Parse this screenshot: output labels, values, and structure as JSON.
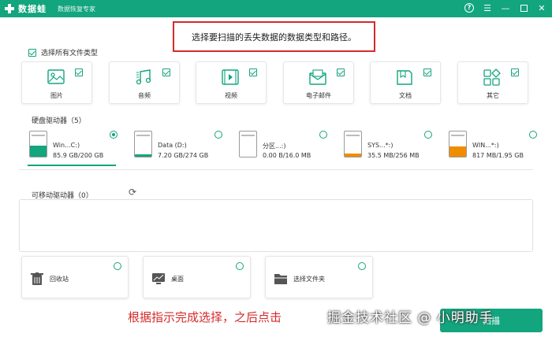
{
  "titlebar": {
    "app_name": "数据蛙",
    "subtitle": "数据恢复专家",
    "help_icon": "question-circle-icon",
    "menu_icon": "hamburger-icon",
    "min_icon": "minimize-icon",
    "max_icon": "restore-icon",
    "close_icon": "close-icon"
  },
  "banner": "选择要扫描的丢失数据的数据类型和路径。",
  "select_all": {
    "label": "选择所有文件类型",
    "checked": true
  },
  "file_types": [
    {
      "label": "图片",
      "icon": "image-icon",
      "checked": true
    },
    {
      "label": "音频",
      "icon": "music-icon",
      "checked": true
    },
    {
      "label": "视频",
      "icon": "video-icon",
      "checked": true
    },
    {
      "label": "电子邮件",
      "icon": "email-icon",
      "checked": true
    },
    {
      "label": "文档",
      "icon": "document-icon",
      "checked": true
    },
    {
      "label": "其它",
      "icon": "other-icon",
      "checked": true
    }
  ],
  "hard_drives": {
    "label": "硬盘驱动器（5）",
    "items": [
      {
        "name": "Win...C:)",
        "size": "85.9 GB/200 GB",
        "used_fraction": 0.43,
        "color": "#12a57e",
        "selected": true
      },
      {
        "name": "Data (D:)",
        "size": "7.20 GB/274 GB",
        "used_fraction": 0.03,
        "color": "#12a57e",
        "selected": false
      },
      {
        "name": "分区...:)",
        "size": "0.00  B/16.0 MB",
        "used_fraction": 0.0,
        "color": "#f08c00",
        "selected": false
      },
      {
        "name": "SYS...*:)",
        "size": "35.5 MB/256 MB",
        "used_fraction": 0.14,
        "color": "#f08c00",
        "selected": false
      },
      {
        "name": "WIN...*:)",
        "size": "817 MB/1.95 GB",
        "used_fraction": 0.42,
        "color": "#f08c00",
        "selected": false
      }
    ]
  },
  "removable": {
    "label": "可移动驱动器（0）",
    "refresh_icon": "refresh-icon"
  },
  "locations": [
    {
      "label": "回收站",
      "icon": "recycle-bin-icon"
    },
    {
      "label": "桌面",
      "icon": "desktop-icon"
    },
    {
      "label": "选择文件夹",
      "icon": "folder-icon"
    }
  ],
  "caption": "根据指示完成选择，之后点击",
  "start_button": "扫描",
  "watermark": "掘金技术社区 @ 小明助手",
  "colors": {
    "accent": "#12a57e",
    "warning": "#f08c00",
    "highlight": "#d42a2a"
  }
}
